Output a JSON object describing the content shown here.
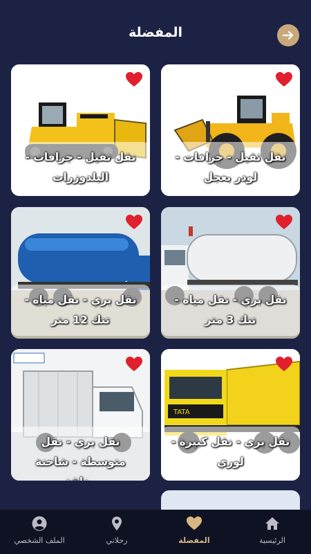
{
  "header": {
    "title": "المفضلة",
    "back_icon": "arrow-right-icon"
  },
  "cards": [
    {
      "label": "نقل ثقيل - جرافات - لودر بعجل",
      "scene": "wheel-loader",
      "favorite": true
    },
    {
      "label": "نقل ثقيل - جرافات - البلدوزرات",
      "scene": "bulldozer",
      "favorite": true
    },
    {
      "label": "نقل بري - نقل مياه - تنك 3 متر",
      "scene": "white-tanker",
      "favorite": true
    },
    {
      "label": "نقل بري - نقل مياه - تنك 12 متر",
      "scene": "blue-tanker",
      "favorite": true
    },
    {
      "label": "نقل بري - نقل كبيرة - لوري",
      "scene": "tipper-truck",
      "favorite": true
    },
    {
      "label": "نقل بري - نقل متوسطة - شاحنة مغلقة",
      "scene": "box-truck",
      "favorite": true
    }
  ],
  "nav": {
    "home": "الرئيسية",
    "favorites": "المفضلة",
    "trips": "رحلاتي",
    "profile": "الملف الشخصي",
    "active": "favorites"
  },
  "colors": {
    "background": "#1c2244",
    "accent": "#c9a97a",
    "heart": "#e0202c",
    "nav_bg": "#0f1222"
  }
}
